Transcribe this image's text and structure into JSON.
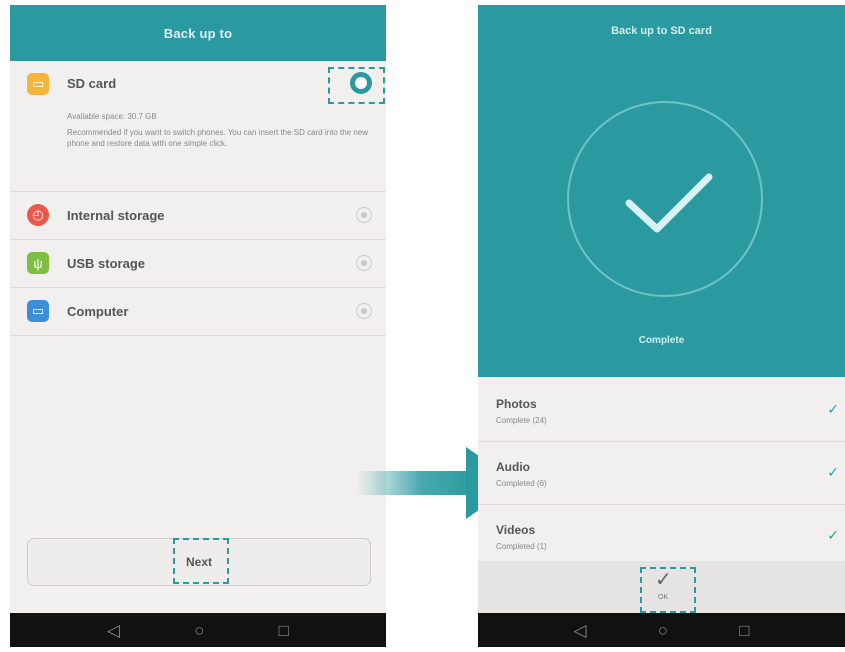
{
  "left": {
    "title": "Back up to",
    "options": [
      {
        "label": "SD card",
        "icon": "sd-card-icon",
        "icon_color": "#f4b637",
        "selected": true
      },
      {
        "label": "Internal storage",
        "icon": "internal-storage-icon",
        "icon_color": "#e9584a",
        "selected": false
      },
      {
        "label": "USB storage",
        "icon": "usb-icon",
        "icon_color": "#7fbf3f",
        "selected": false
      },
      {
        "label": "Computer",
        "icon": "computer-icon",
        "icon_color": "#3c8ed6",
        "selected": false
      }
    ],
    "sd_available": "Available space: 30.7 GB",
    "sd_description": "Recommended if you want to switch phones. You can insert the SD card into the new phone and restore data with one simple click.",
    "next_label": "Next"
  },
  "right": {
    "title": "Back up to SD card",
    "status": "Complete",
    "results": [
      {
        "title": "Photos",
        "sub": "Complete (24)"
      },
      {
        "title": "Audio",
        "sub": "Completed (6)"
      },
      {
        "title": "Videos",
        "sub": "Completed (1)"
      }
    ],
    "done_label": "OK"
  },
  "colors": {
    "accent": "#2b9aa0"
  }
}
